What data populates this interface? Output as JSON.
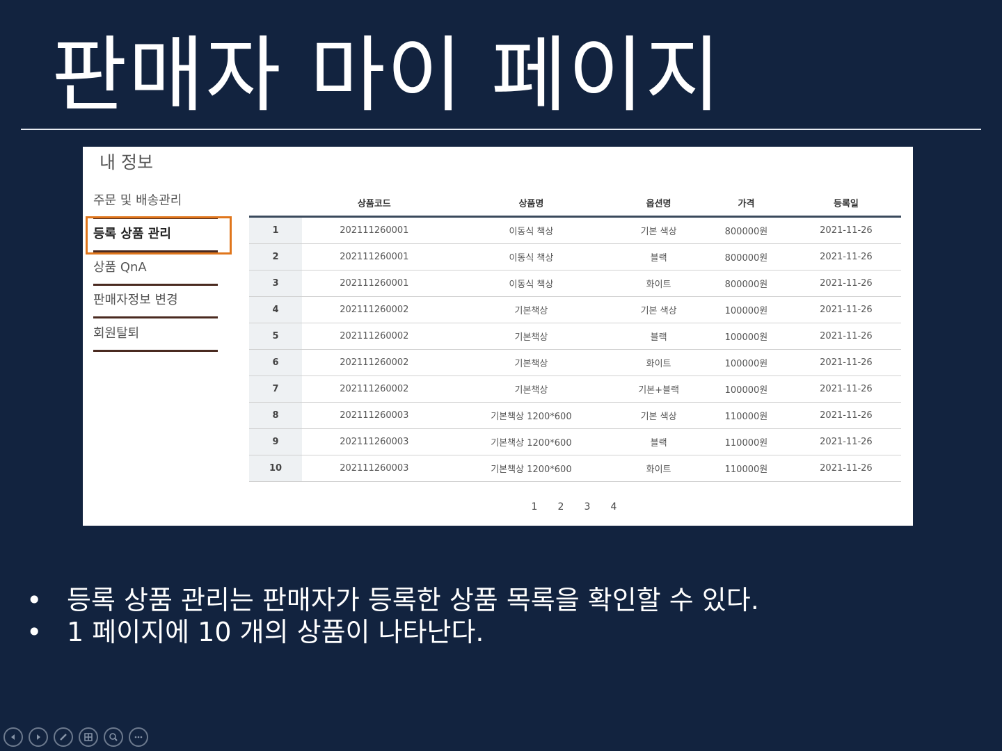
{
  "slide": {
    "title": "판매자 마이 페이지",
    "bullets": [
      "등록 상품 관리는 판매자가 등록한 상품 목록을 확인할 수 있다.",
      "1 페이지에 10 개의 상품이 나타난다."
    ],
    "bullet_symbol": "•"
  },
  "panel": {
    "heading": "내 정보",
    "sidebar": [
      {
        "label": "주문 및 배송관리"
      },
      {
        "label": "등록 상품 관리"
      },
      {
        "label": "상품 QnA"
      },
      {
        "label": "판매자정보 변경"
      },
      {
        "label": "회원탈퇴"
      }
    ],
    "table": {
      "headers": [
        "",
        "상품코드",
        "상품명",
        "옵션명",
        "가격",
        "등록일"
      ],
      "rows": [
        [
          "1",
          "202111260001",
          "이동식 책상",
          "기본 색상",
          "800000원",
          "2021-11-26"
        ],
        [
          "2",
          "202111260001",
          "이동식 책상",
          "블랙",
          "800000원",
          "2021-11-26"
        ],
        [
          "3",
          "202111260001",
          "이동식 책상",
          "화이트",
          "800000원",
          "2021-11-26"
        ],
        [
          "4",
          "202111260002",
          "기본책상",
          "기본 색상",
          "100000원",
          "2021-11-26"
        ],
        [
          "5",
          "202111260002",
          "기본책상",
          "블랙",
          "100000원",
          "2021-11-26"
        ],
        [
          "6",
          "202111260002",
          "기본책상",
          "화이트",
          "100000원",
          "2021-11-26"
        ],
        [
          "7",
          "202111260002",
          "기본책상",
          "기본+블랙",
          "100000원",
          "2021-11-26"
        ],
        [
          "8",
          "202111260003",
          "기본책상 1200*600",
          "기본 색상",
          "110000원",
          "2021-11-26"
        ],
        [
          "9",
          "202111260003",
          "기본책상 1200*600",
          "블랙",
          "110000원",
          "2021-11-26"
        ],
        [
          "10",
          "202111260003",
          "기본책상 1200*600",
          "화이트",
          "110000원",
          "2021-11-26"
        ]
      ]
    },
    "pagination": [
      "1",
      "2",
      "3",
      "4"
    ]
  },
  "colors": {
    "background": "#12233f",
    "highlight": "#e0761c",
    "sidebar_underline": "#4a2a20"
  }
}
